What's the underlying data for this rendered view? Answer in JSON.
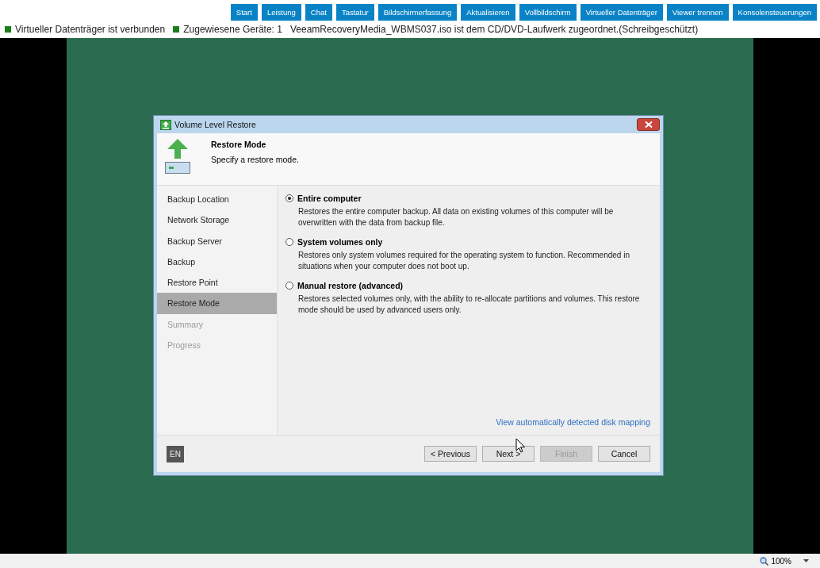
{
  "toolbar": {
    "buttons": [
      "Start",
      "Leistung",
      "Chat",
      "Tastatur",
      "Bildschirmerfassung",
      "Aktualisieren",
      "Vollbildschirm",
      "Virtueller Datenträger",
      "Viewer trennen",
      "Konsolensteuerungen"
    ]
  },
  "status_line": [
    {
      "text": "Virtueller Datenträger ist verbunden",
      "color": "#1a7f1a"
    },
    {
      "text": "Zugewiesene Geräte: 1",
      "color": "#1a7f1a"
    },
    {
      "text": "VeeamRecoveryMedia_WBMS037.iso ist dem CD/DVD-Laufwerk zugeordnet.(Schreibgeschützt)"
    }
  ],
  "dialog": {
    "title": "Volume Level Restore",
    "header": {
      "title": "Restore Mode",
      "subtitle": "Specify a restore mode."
    },
    "steps": [
      {
        "label": "Backup Location",
        "selected": false,
        "disabled": false
      },
      {
        "label": "Network Storage",
        "selected": false,
        "disabled": false
      },
      {
        "label": "Backup Server",
        "selected": false,
        "disabled": false
      },
      {
        "label": "Backup",
        "selected": false,
        "disabled": false
      },
      {
        "label": "Restore Point",
        "selected": false,
        "disabled": false
      },
      {
        "label": "Restore Mode",
        "selected": true,
        "disabled": false
      },
      {
        "label": "Summary",
        "selected": false,
        "disabled": true
      },
      {
        "label": "Progress",
        "selected": false,
        "disabled": true
      }
    ],
    "options": [
      {
        "label": "Entire computer",
        "description": "Restores the entire computer backup. All data on existing volumes of this computer will be overwritten with the data from backup file.",
        "selected": true
      },
      {
        "label": "System volumes only",
        "description": "Restores only system volumes required for the operating system to function. Recommended in situations when your computer does not boot up.",
        "selected": false
      },
      {
        "label": "Manual restore (advanced)",
        "description": "Restores selected volumes only, with the ability to re-allocate partitions and volumes. This restore mode should be used by advanced users only.",
        "selected": false
      }
    ],
    "link": "View automatically detected disk mapping",
    "language": "EN",
    "buttons": [
      {
        "label": "< Previous",
        "disabled": false
      },
      {
        "label": "Next >",
        "disabled": false
      },
      {
        "label": "Finish",
        "disabled": true
      },
      {
        "label": "Cancel",
        "disabled": false
      }
    ]
  },
  "zoom": {
    "value": "100%"
  }
}
